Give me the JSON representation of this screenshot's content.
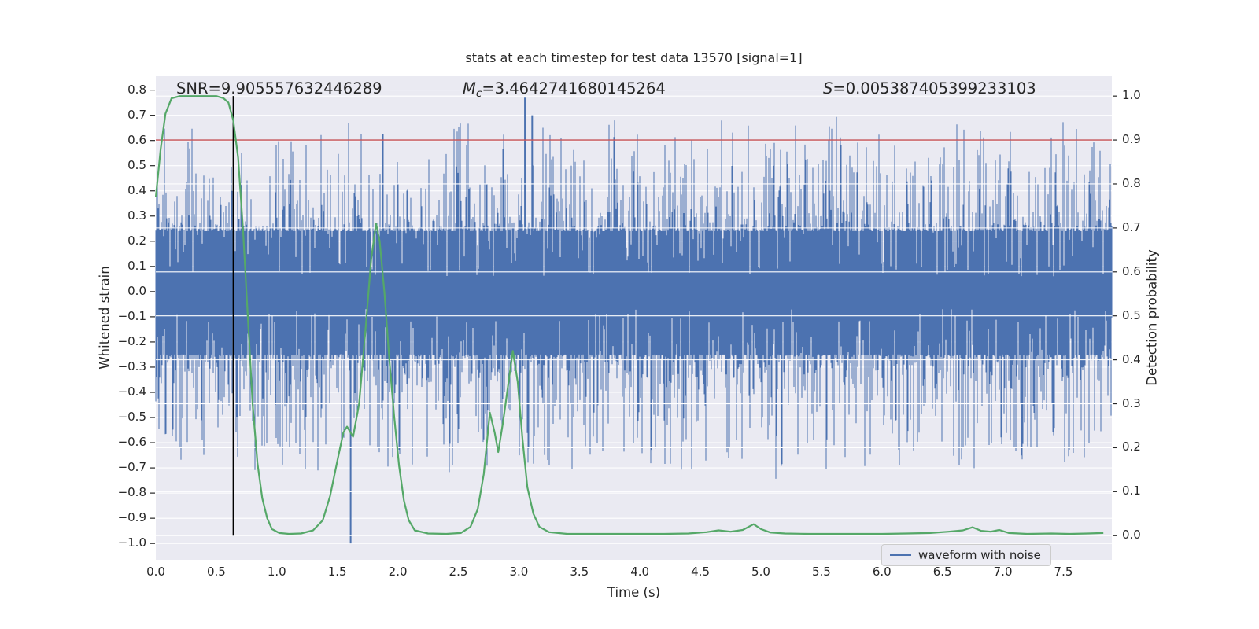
{
  "title": "stats at each timestep for test data 13570 [signal=1]",
  "annotations": {
    "snr": "SNR=9.905557632446289",
    "mc_var": "M",
    "mc_sub": "c",
    "mc_value": "=3.4642741680145264",
    "s_var": "S",
    "s_value": "=0.005387405399233103"
  },
  "axis_labels": {
    "x": "Time (s)",
    "y_left": "Whitened strain",
    "y_right": "Detection probability"
  },
  "legend": {
    "waveform_label": "waveform with noise"
  },
  "colors": {
    "plot_bg": "#eaeaf2",
    "grid": "#ffffff",
    "noise_blue": "#4c72b0",
    "prob_green": "#55a868",
    "threshold_red": "#c44e52",
    "event_black": "#000000",
    "text": "#262626"
  },
  "chart_data": {
    "type": "line",
    "title": "stats at each timestep for test data 13570 [signal=1]",
    "xlabel": "Time (s)",
    "ylabel_left": "Whitened strain",
    "ylabel_right": "Detection probability",
    "xlim": [
      0,
      7.9
    ],
    "ylim_left": [
      -1.065,
      0.855
    ],
    "ylim_right": [
      -0.055,
      1.045
    ],
    "x_ticks": [
      0.0,
      0.5,
      1.0,
      1.5,
      2.0,
      2.5,
      3.0,
      3.5,
      4.0,
      4.5,
      5.0,
      5.5,
      6.0,
      6.5,
      7.0,
      7.5
    ],
    "y_ticks_left": [
      0.8,
      0.7,
      0.6,
      0.5,
      0.4,
      0.3,
      0.2,
      0.1,
      0.0,
      -0.1,
      -0.2,
      -0.3,
      -0.4,
      -0.5,
      -0.6,
      -0.7,
      -0.8,
      -0.9,
      -1.0
    ],
    "y_ticks_right": [
      1.0,
      0.9,
      0.8,
      0.7,
      0.6,
      0.5,
      0.4,
      0.3,
      0.2,
      0.1,
      0.0
    ],
    "grid": true,
    "legend_position": "lower right",
    "stats": {
      "SNR": 9.905557632446289,
      "Mc": 3.4642741680145264,
      "S": 0.005387405399233103
    },
    "threshold_line": {
      "axis": "right",
      "value": 0.9
    },
    "event_vline": {
      "time": 0.64,
      "span_probability": [
        0.0,
        1.0
      ]
    },
    "series": [
      {
        "name": "waveform with noise",
        "type": "noise_fill",
        "axis": "left",
        "description": "dense whitened strain noise, solid core about +/-0.25, spikes tapering to +/-0.75",
        "seed": 20240513,
        "core_half_width": 0.24,
        "spike_max": 0.78,
        "special_spikes": [
          {
            "t": 1.61,
            "strain": -1.0
          },
          {
            "t": 3.05,
            "strain": 0.77
          },
          {
            "t": 3.11,
            "strain": 0.7
          }
        ]
      },
      {
        "name": "detection probability",
        "type": "line",
        "axis": "right",
        "points": [
          [
            0.0,
            0.77
          ],
          [
            0.04,
            0.88
          ],
          [
            0.08,
            0.96
          ],
          [
            0.13,
            0.995
          ],
          [
            0.2,
            1.0
          ],
          [
            0.3,
            1.0
          ],
          [
            0.4,
            1.0
          ],
          [
            0.5,
            1.0
          ],
          [
            0.56,
            0.995
          ],
          [
            0.6,
            0.985
          ],
          [
            0.64,
            0.945
          ],
          [
            0.68,
            0.86
          ],
          [
            0.72,
            0.7
          ],
          [
            0.76,
            0.5
          ],
          [
            0.8,
            0.3
          ],
          [
            0.84,
            0.165
          ],
          [
            0.88,
            0.085
          ],
          [
            0.92,
            0.04
          ],
          [
            0.96,
            0.015
          ],
          [
            1.02,
            0.006
          ],
          [
            1.1,
            0.004
          ],
          [
            1.2,
            0.005
          ],
          [
            1.3,
            0.012
          ],
          [
            1.38,
            0.035
          ],
          [
            1.44,
            0.09
          ],
          [
            1.5,
            0.17
          ],
          [
            1.55,
            0.235
          ],
          [
            1.58,
            0.248
          ],
          [
            1.63,
            0.225
          ],
          [
            1.68,
            0.3
          ],
          [
            1.73,
            0.46
          ],
          [
            1.78,
            0.63
          ],
          [
            1.82,
            0.71
          ],
          [
            1.85,
            0.67
          ],
          [
            1.89,
            0.55
          ],
          [
            1.93,
            0.4
          ],
          [
            1.97,
            0.27
          ],
          [
            2.01,
            0.16
          ],
          [
            2.05,
            0.08
          ],
          [
            2.09,
            0.035
          ],
          [
            2.14,
            0.012
          ],
          [
            2.25,
            0.005
          ],
          [
            2.4,
            0.004
          ],
          [
            2.52,
            0.006
          ],
          [
            2.6,
            0.02
          ],
          [
            2.66,
            0.06
          ],
          [
            2.71,
            0.14
          ],
          [
            2.76,
            0.28
          ],
          [
            2.8,
            0.235
          ],
          [
            2.83,
            0.19
          ],
          [
            2.87,
            0.26
          ],
          [
            2.91,
            0.34
          ],
          [
            2.95,
            0.42
          ],
          [
            2.99,
            0.35
          ],
          [
            3.03,
            0.22
          ],
          [
            3.07,
            0.11
          ],
          [
            3.12,
            0.05
          ],
          [
            3.17,
            0.02
          ],
          [
            3.25,
            0.008
          ],
          [
            3.4,
            0.004
          ],
          [
            3.6,
            0.004
          ],
          [
            3.8,
            0.004
          ],
          [
            4.0,
            0.004
          ],
          [
            4.2,
            0.004
          ],
          [
            4.4,
            0.005
          ],
          [
            4.55,
            0.008
          ],
          [
            4.65,
            0.012
          ],
          [
            4.75,
            0.009
          ],
          [
            4.85,
            0.013
          ],
          [
            4.94,
            0.026
          ],
          [
            5.0,
            0.015
          ],
          [
            5.08,
            0.007
          ],
          [
            5.2,
            0.005
          ],
          [
            5.4,
            0.004
          ],
          [
            5.6,
            0.004
          ],
          [
            5.8,
            0.004
          ],
          [
            6.0,
            0.004
          ],
          [
            6.2,
            0.005
          ],
          [
            6.4,
            0.006
          ],
          [
            6.55,
            0.009
          ],
          [
            6.67,
            0.012
          ],
          [
            6.75,
            0.019
          ],
          [
            6.82,
            0.011
          ],
          [
            6.9,
            0.009
          ],
          [
            6.97,
            0.013
          ],
          [
            7.05,
            0.006
          ],
          [
            7.2,
            0.004
          ],
          [
            7.4,
            0.005
          ],
          [
            7.55,
            0.004
          ],
          [
            7.7,
            0.005
          ],
          [
            7.83,
            0.006
          ]
        ]
      }
    ]
  }
}
